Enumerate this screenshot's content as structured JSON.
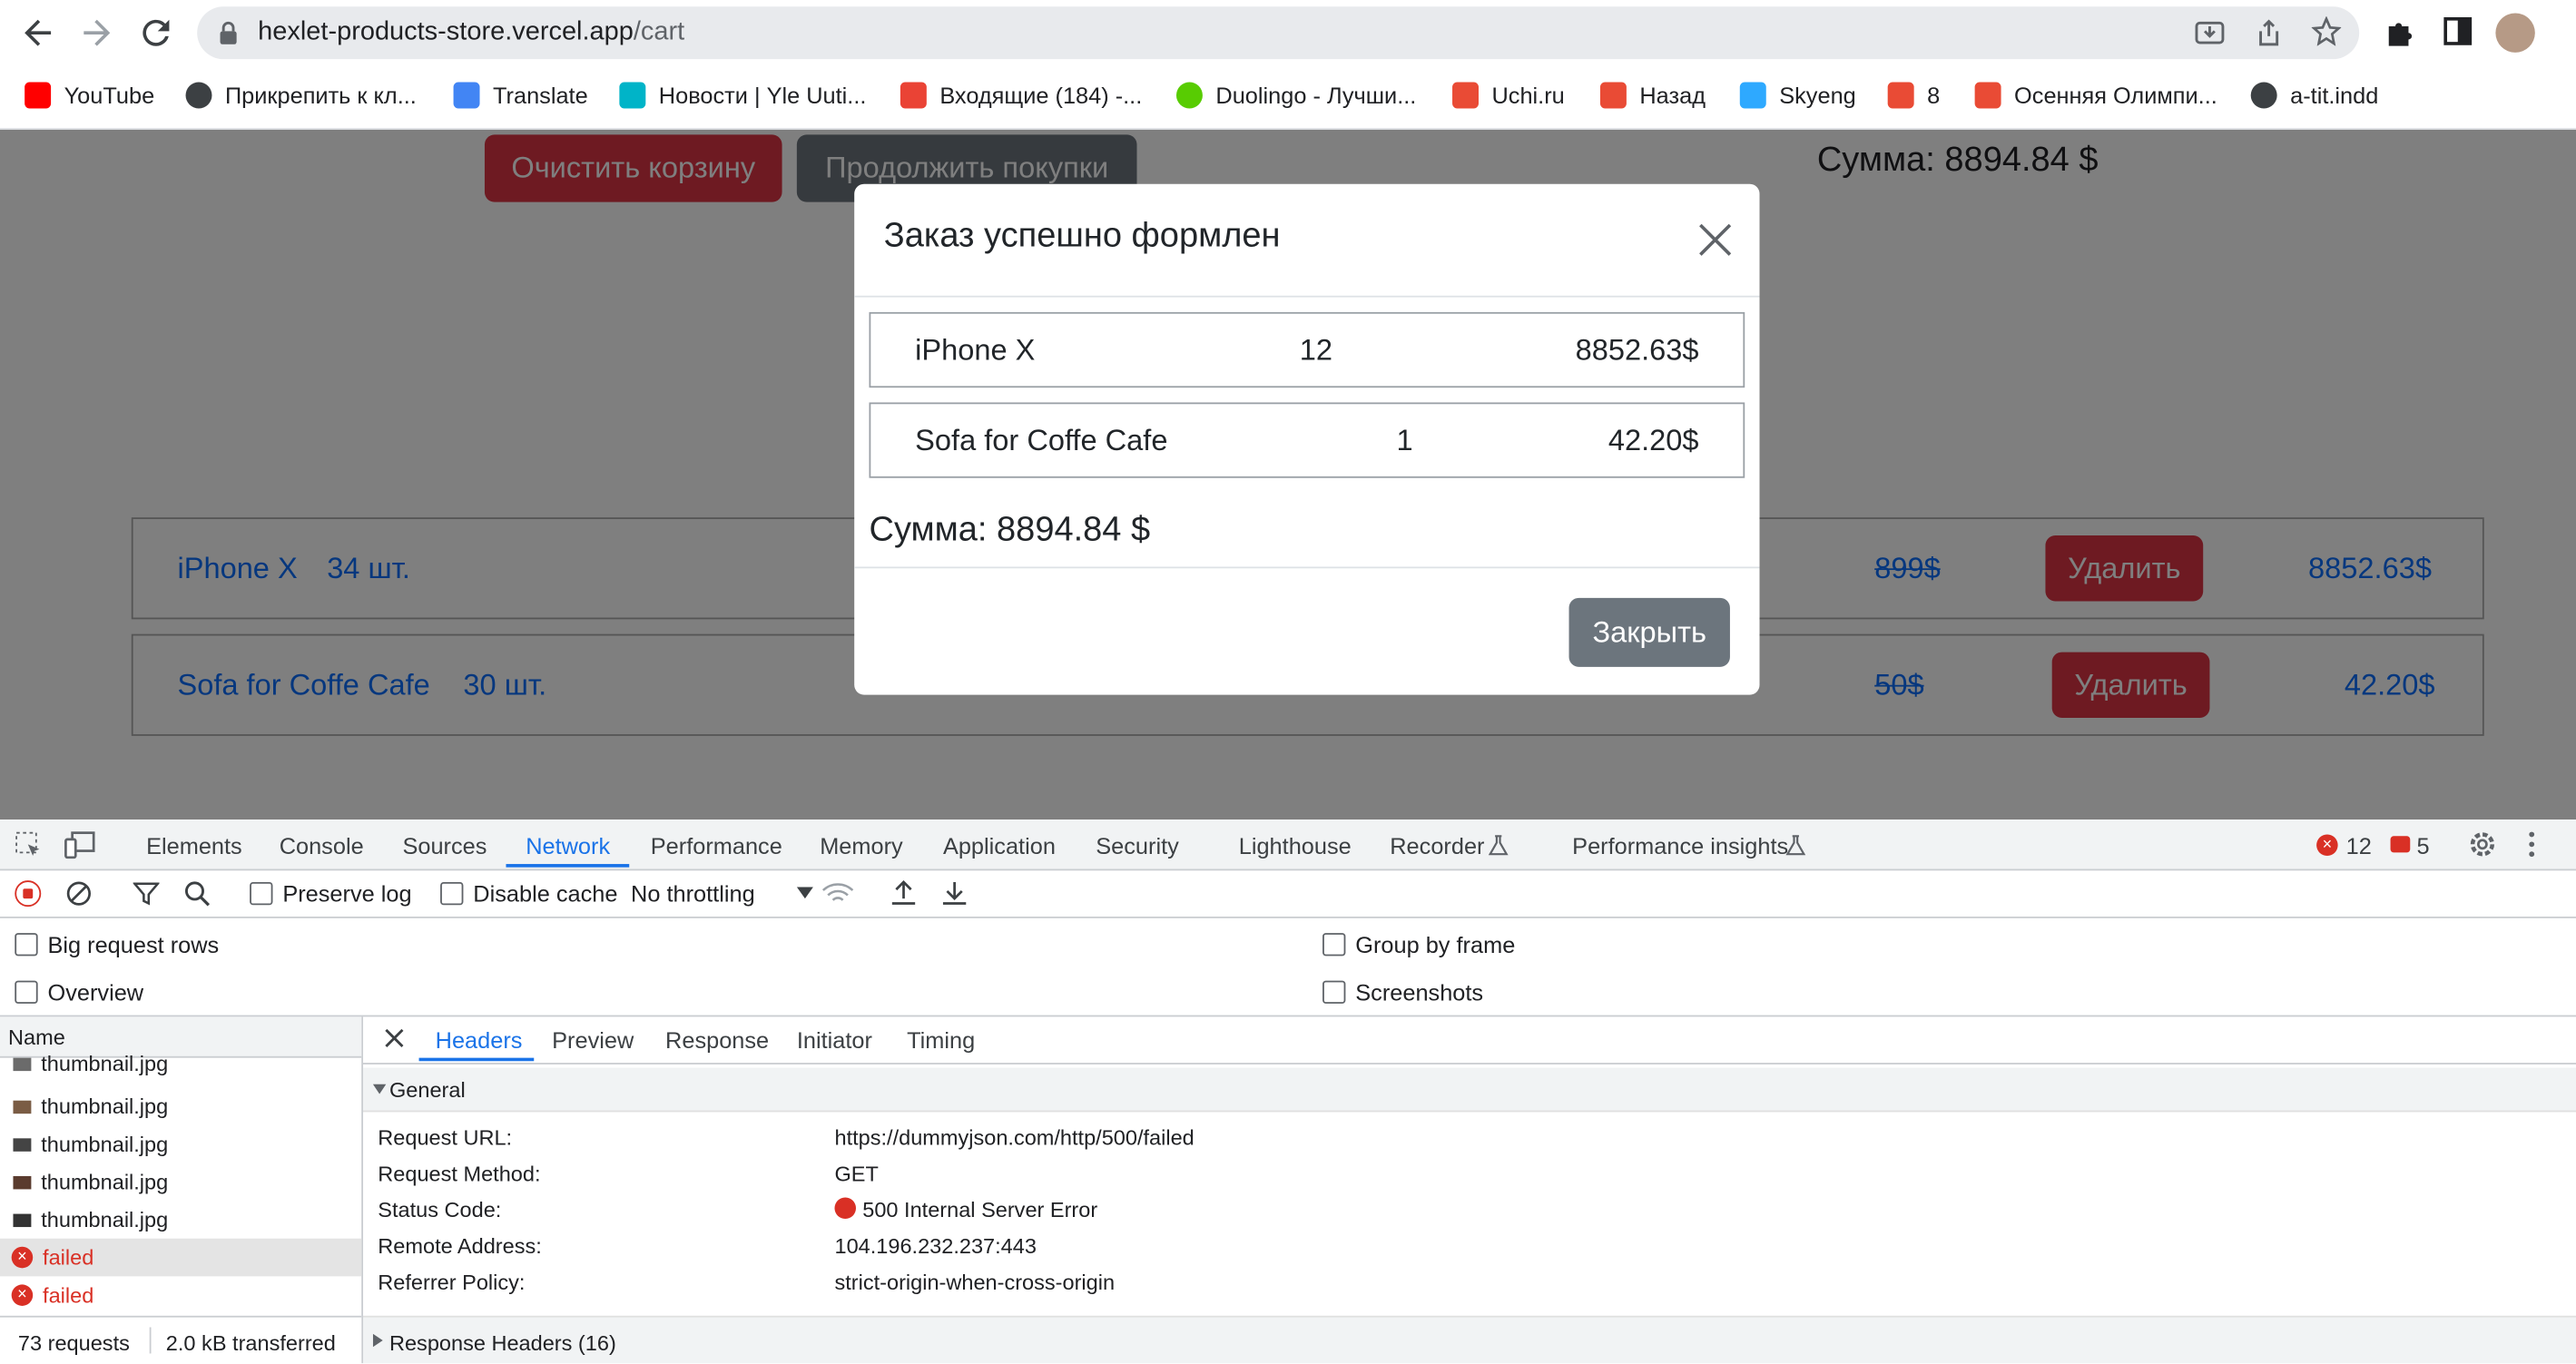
{
  "browser": {
    "url_host": "hexlet-products-store.vercel.app",
    "url_path": "/cart",
    "bookmarks": [
      {
        "label": "YouTube",
        "icon": "youtube-icon",
        "color": "#ff0000"
      },
      {
        "label": "Прикрепить к кл...",
        "icon": "globe-icon",
        "color": "#3c4043"
      },
      {
        "label": "Translate",
        "icon": "translate-icon",
        "color": "#4285f4"
      },
      {
        "label": "Новости | Yle Uuti...",
        "icon": "yle-icon",
        "color": "#00b4c8"
      },
      {
        "label": "Входящие (184) -...",
        "icon": "gmail-icon",
        "color": "#ea4335"
      },
      {
        "label": "Duolingo - Лучши...",
        "icon": "duolingo-icon",
        "color": "#58cc02"
      },
      {
        "label": "Uchi.ru",
        "icon": "uchi-icon",
        "color": "#e94b35"
      },
      {
        "label": "Назад",
        "icon": "uchi-icon",
        "color": "#e94b35"
      },
      {
        "label": "Skyeng",
        "icon": "skyeng-icon",
        "color": "#2ea9ff"
      },
      {
        "label": "8",
        "icon": "uchi-icon",
        "color": "#e94b35"
      },
      {
        "label": "Осенняя Олимпи...",
        "icon": "uchi-icon",
        "color": "#e94b35"
      },
      {
        "label": "a-tit.indd",
        "icon": "globe-icon",
        "color": "#3c4043"
      }
    ]
  },
  "page": {
    "clear_cart": "Очистить корзину",
    "continue_shopping": "Продолжить покупки",
    "sum": "Сумма: 8894.84 $",
    "items": [
      {
        "name": "iPhone X",
        "qty": "34 шт.",
        "old_price": "899$",
        "delete": "Удалить",
        "price": "8852.63$"
      },
      {
        "name": "Sofa for Coffe Cafe",
        "qty": "30 шт.",
        "old_price": "50$",
        "delete": "Удалить",
        "price": "42.20$"
      }
    ]
  },
  "modal": {
    "title": "Заказ успешно формлен",
    "rows": [
      {
        "name": "iPhone X",
        "qty": "12",
        "price": "8852.63$"
      },
      {
        "name": "Sofa for Coffe Cafe",
        "qty": "1",
        "price": "42.20$"
      }
    ],
    "sum": "Сумма: 8894.84 $",
    "close_button": "Закрыть"
  },
  "devtools": {
    "tabs": [
      "Elements",
      "Console",
      "Sources",
      "Network",
      "Performance",
      "Memory",
      "Application",
      "Security",
      "Lighthouse",
      "Recorder",
      "Performance insights"
    ],
    "active_tab": "Network",
    "errors": "12",
    "warnings": "5",
    "preserve_log": "Preserve log",
    "disable_cache": "Disable cache",
    "throttling": "No throttling",
    "big_request_rows": "Big request rows",
    "overview": "Overview",
    "group_by_frame": "Group by frame",
    "screenshots": "Screenshots",
    "name_header": "Name",
    "requests": [
      {
        "name": "thumbnail.jpg",
        "failed": false
      },
      {
        "name": "thumbnail.jpg",
        "failed": false
      },
      {
        "name": "thumbnail.jpg",
        "failed": false
      },
      {
        "name": "thumbnail.jpg",
        "failed": false
      },
      {
        "name": "thumbnail.jpg",
        "failed": false
      },
      {
        "name": "failed",
        "failed": true
      },
      {
        "name": "failed",
        "failed": true
      }
    ],
    "footer_requests": "73 requests",
    "footer_transferred": "2.0 kB transferred",
    "detail_tabs": [
      "Headers",
      "Preview",
      "Response",
      "Initiator",
      "Timing"
    ],
    "general_label": "General",
    "headers": [
      {
        "key": "Request URL:",
        "value": "https://dummyjson.com/http/500/failed"
      },
      {
        "key": "Request Method:",
        "value": "GET"
      },
      {
        "key": "Status Code:",
        "value": "500 Internal Server Error"
      },
      {
        "key": "Remote Address:",
        "value": "104.196.232.237:443"
      },
      {
        "key": "Referrer Policy:",
        "value": "strict-origin-when-cross-origin"
      }
    ],
    "response_headers": "Response Headers (16)"
  }
}
